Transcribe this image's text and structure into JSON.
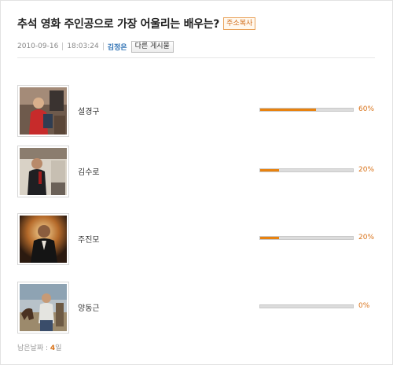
{
  "poll": {
    "title": "추석 영화 주인공으로 가장 어울리는 배우는?",
    "copy_address_label": "주소복사",
    "date": "2010-09-16",
    "time": "18:03:24",
    "author": "김정은",
    "other_posts_label": "다른 게시물",
    "options": [
      {
        "name": "설경구",
        "percent": 60,
        "percent_label": "60%",
        "photo_icon": "actor-photo-on-set"
      },
      {
        "name": "김수로",
        "percent": 20,
        "percent_label": "20%",
        "photo_icon": "actor-photo-film-still"
      },
      {
        "name": "주진모",
        "percent": 20,
        "percent_label": "20%",
        "photo_icon": "actor-photo-portrait"
      },
      {
        "name": "양동근",
        "percent": 0,
        "percent_label": "0%",
        "photo_icon": "actor-photo-horse-racing"
      }
    ],
    "remaining_label": "남은날짜 :",
    "remaining_days": "4",
    "remaining_unit": "일"
  },
  "colors": {
    "accent": "#e8820f",
    "author": "#2b6fb3",
    "track": "#dcdcdc"
  }
}
